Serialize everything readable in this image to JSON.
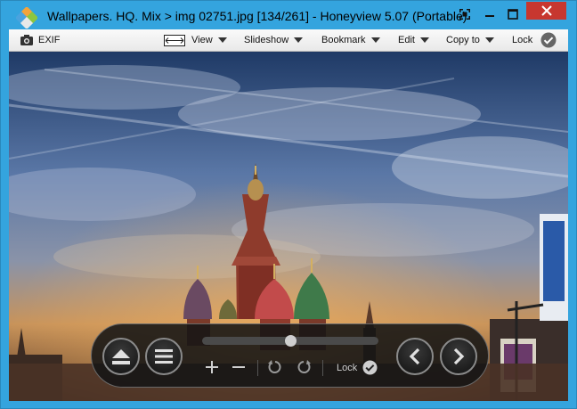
{
  "window": {
    "title": "Wallpapers. HQ. Mix > img 02751.jpg [134/261] - Honeyview 5.07 (Portable)"
  },
  "toolbar": {
    "exif_label": "EXIF",
    "view_label": "View",
    "slideshow_label": "Slideshow",
    "bookmark_label": "Bookmark",
    "edit_label": "Edit",
    "copy_to_label": "Copy to",
    "lock_label": "Lock"
  },
  "controls": {
    "lock_label": "Lock"
  },
  "colors": {
    "window_frame": "#34a4de",
    "close_button": "#c7372f",
    "control_bar": "#141414"
  }
}
